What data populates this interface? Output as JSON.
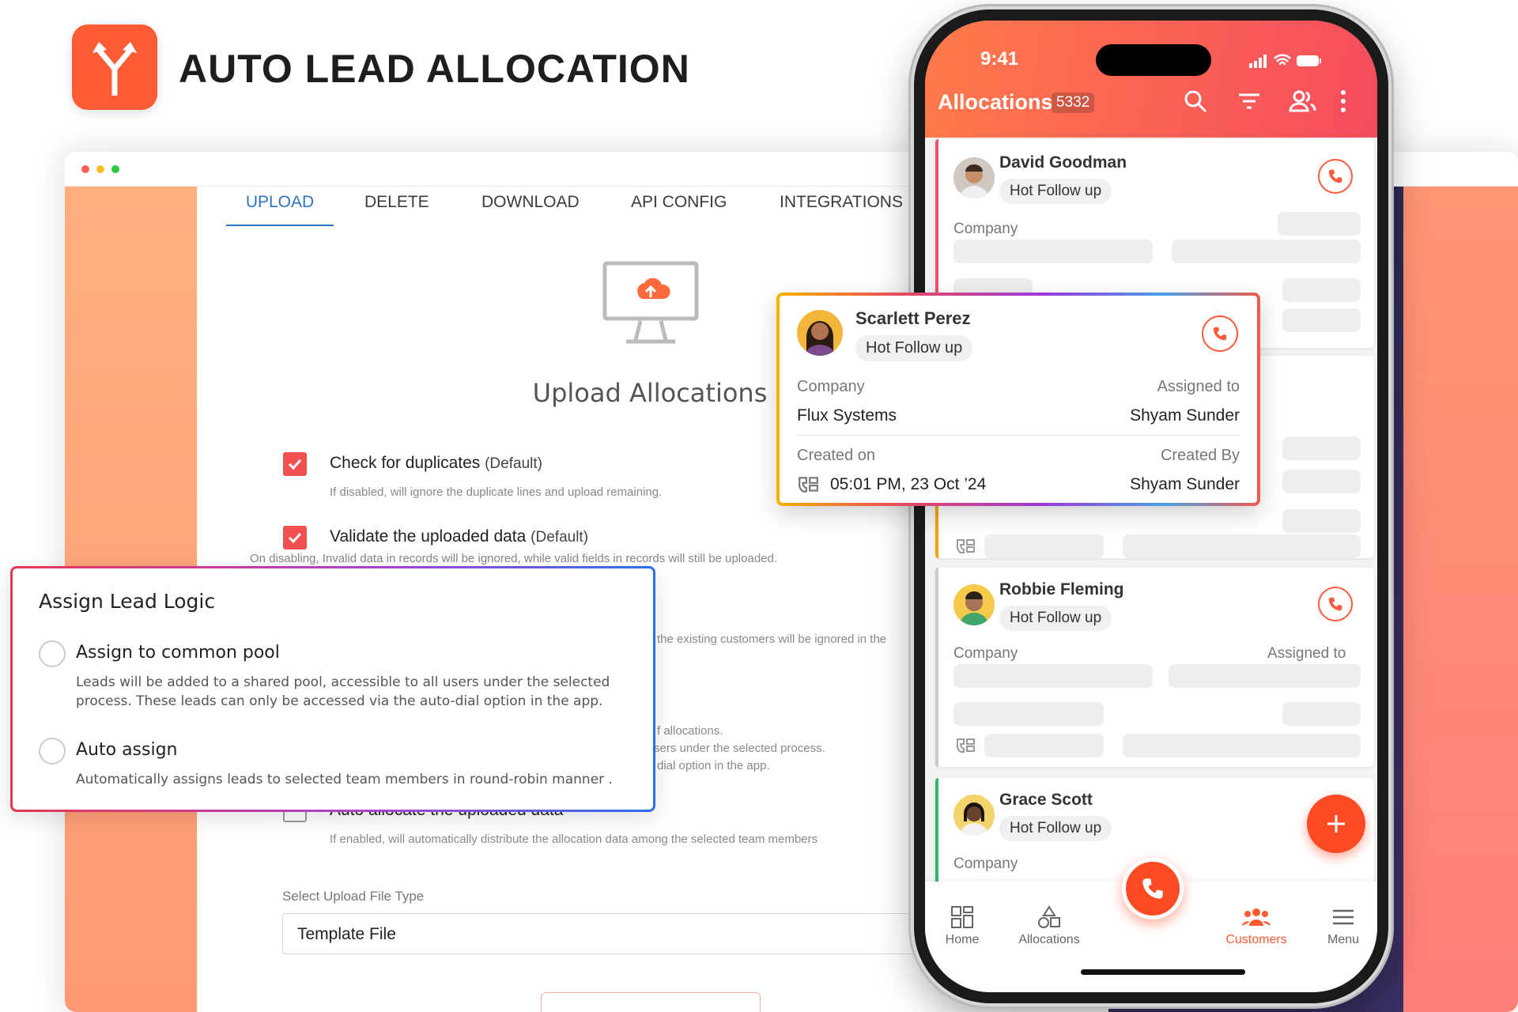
{
  "hero": {
    "title": "AUTO LEAD ALLOCATION"
  },
  "tabs": [
    "UPLOAD",
    "DELETE",
    "DOWNLOAD",
    "API CONFIG",
    "INTEGRATIONS"
  ],
  "upload": {
    "title": "Upload Allocations",
    "options": [
      {
        "label": "Check for duplicates",
        "suffix": "(Default)",
        "hint": "If disabled, will ignore the duplicate lines and upload remaining.",
        "checked": true
      },
      {
        "label": "Validate the uploaded data",
        "suffix": "(Default)",
        "hint": "On disabling, Invalid data in records will be ignored, while valid fields in records will still be uploaded.",
        "checked": true
      },
      {
        "label": "Auto allocate the uploaded data",
        "suffix": "",
        "hint": "If enabled, will automatically distribute the allocation data among the selected team members",
        "checked": false
      }
    ],
    "behind_text": [
      "the existing customers will be ignored in the",
      "f allocations.",
      "sers under the selected process.",
      "dial option in the app."
    ],
    "file_type_label": "Select Upload File Type",
    "file_type_value": "Template File"
  },
  "assign_logic": {
    "title": "Assign Lead Logic",
    "options": [
      {
        "label": "Assign to common pool",
        "desc": "Leads will be added to a shared pool, accessible to all users under the selected process. These leads can only be accessed via the auto-dial option in the app."
      },
      {
        "label": "Auto assign",
        "desc": "Automatically assigns leads to selected team members in round-robin manner ."
      }
    ]
  },
  "phone": {
    "time": "9:41",
    "title": "Allocations",
    "count": "5332",
    "cards": [
      {
        "name": "David Goodman",
        "tag": "Hot Follow up",
        "company_label": "Company",
        "stripe": "#f0506e"
      },
      {
        "name": "Robbie Fleming",
        "tag": "Hot Follow up",
        "company_label": "Company",
        "assigned_label": "Assigned to",
        "stripe": "#c9c9cf"
      },
      {
        "name": "Grace Scott",
        "tag": "Hot Follow up",
        "company_label": "Company",
        "stripe": "#2fb866"
      }
    ],
    "nav": [
      {
        "label": "Home",
        "icon": "grid-icon",
        "active": false
      },
      {
        "label": "Allocations",
        "icon": "shapes-icon",
        "active": false
      },
      {
        "label": "Customers",
        "icon": "users-icon",
        "active": true
      },
      {
        "label": "Menu",
        "icon": "hamburger-icon",
        "active": false
      }
    ]
  },
  "detail": {
    "name": "Scarlett Perez",
    "tag": "Hot Follow up",
    "company_label": "Company",
    "company": "Flux Systems",
    "assigned_label": "Assigned to",
    "assigned": "Shyam Sunder",
    "created_on_label": "Created on",
    "created_on": "05:01 PM, 23 Oct ’24",
    "created_by_label": "Created By",
    "created_by": "Shyam Sunder"
  },
  "colors": {
    "brand": "#ff5c36",
    "accent": "#2d73c3",
    "check": "#f05050"
  }
}
